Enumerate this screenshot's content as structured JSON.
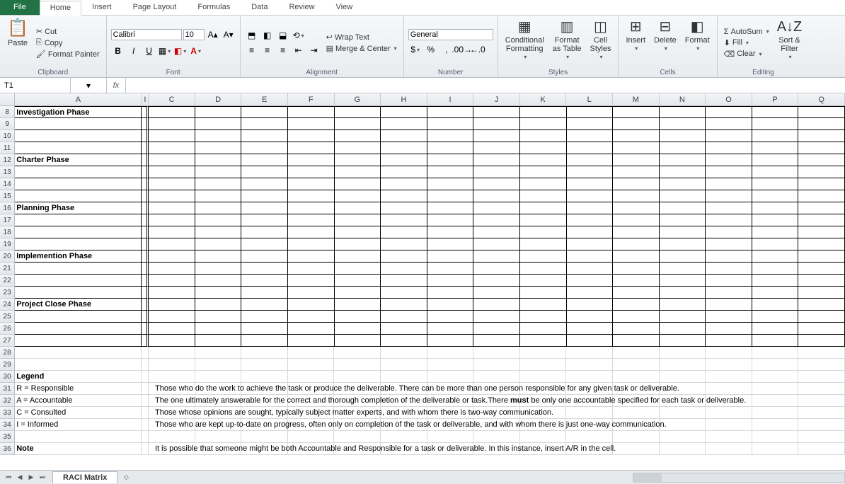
{
  "tabs": {
    "file": "File",
    "items": [
      "Home",
      "Insert",
      "Page Layout",
      "Formulas",
      "Data",
      "Review",
      "View"
    ],
    "active": 0
  },
  "ribbon": {
    "clipboard": {
      "label": "Clipboard",
      "paste": "Paste",
      "cut": "Cut",
      "copy": "Copy",
      "painter": "Format Painter"
    },
    "font": {
      "label": "Font",
      "name": "Calibri",
      "size": "10"
    },
    "alignment": {
      "label": "Alignment",
      "wrap": "Wrap Text",
      "merge": "Merge & Center"
    },
    "number": {
      "label": "Number",
      "format": "General"
    },
    "styles": {
      "label": "Styles",
      "cond": "Conditional\nFormatting",
      "table": "Format\nas Table",
      "cell": "Cell\nStyles"
    },
    "cells": {
      "label": "Cells",
      "insert": "Insert",
      "delete": "Delete",
      "format": "Format"
    },
    "editing": {
      "label": "Editing",
      "autosum": "AutoSum",
      "fill": "Fill",
      "clear": "Clear",
      "sort": "Sort &\nFilter"
    }
  },
  "namebox": "T1",
  "columns": [
    "A",
    "I",
    "C",
    "D",
    "E",
    "F",
    "G",
    "H",
    "I",
    "J",
    "K",
    "L",
    "M",
    "N",
    "O",
    "P",
    "Q"
  ],
  "rows": [
    8,
    9,
    10,
    11,
    12,
    13,
    14,
    15,
    16,
    17,
    18,
    19,
    20,
    21,
    22,
    23,
    24,
    25,
    26,
    27,
    28,
    29,
    30,
    31,
    32,
    33,
    34,
    35,
    36
  ],
  "phases": {
    "8": "Investigation Phase",
    "12": "Charter Phase",
    "16": "Planning Phase",
    "20": "Implemention Phase",
    "24": "Project Close Phase"
  },
  "legend": {
    "title": "Legend",
    "r": {
      "k": "R = Responsible",
      "v": "Those who do the work to achieve the task or produce the deliverable. There can be more than one person responsible for any given task or deliverable."
    },
    "a": {
      "k": "A = Accountable",
      "v_pre": "The one ultimately answerable for the correct and thorough completion of the deliverable or task.There ",
      "v_bold": "must",
      "v_post": " be only one accountable specified for each task or deliverable."
    },
    "c": {
      "k": "C = Consulted",
      "v": "Those whose opinions are sought, typically subject matter experts, and with whom there is two-way communication."
    },
    "i": {
      "k": "I = Informed",
      "v": "Those who are kept up-to-date on progress, often only on completion of the task or deliverable, and with whom there is just one-way communication."
    },
    "note": {
      "k": "Note",
      "v": "It is possible that someone might be both Accountable and Responsible for a task or deliverable. In this instance, insert A/R in the cell."
    }
  },
  "sheet": "RACI Matrix"
}
